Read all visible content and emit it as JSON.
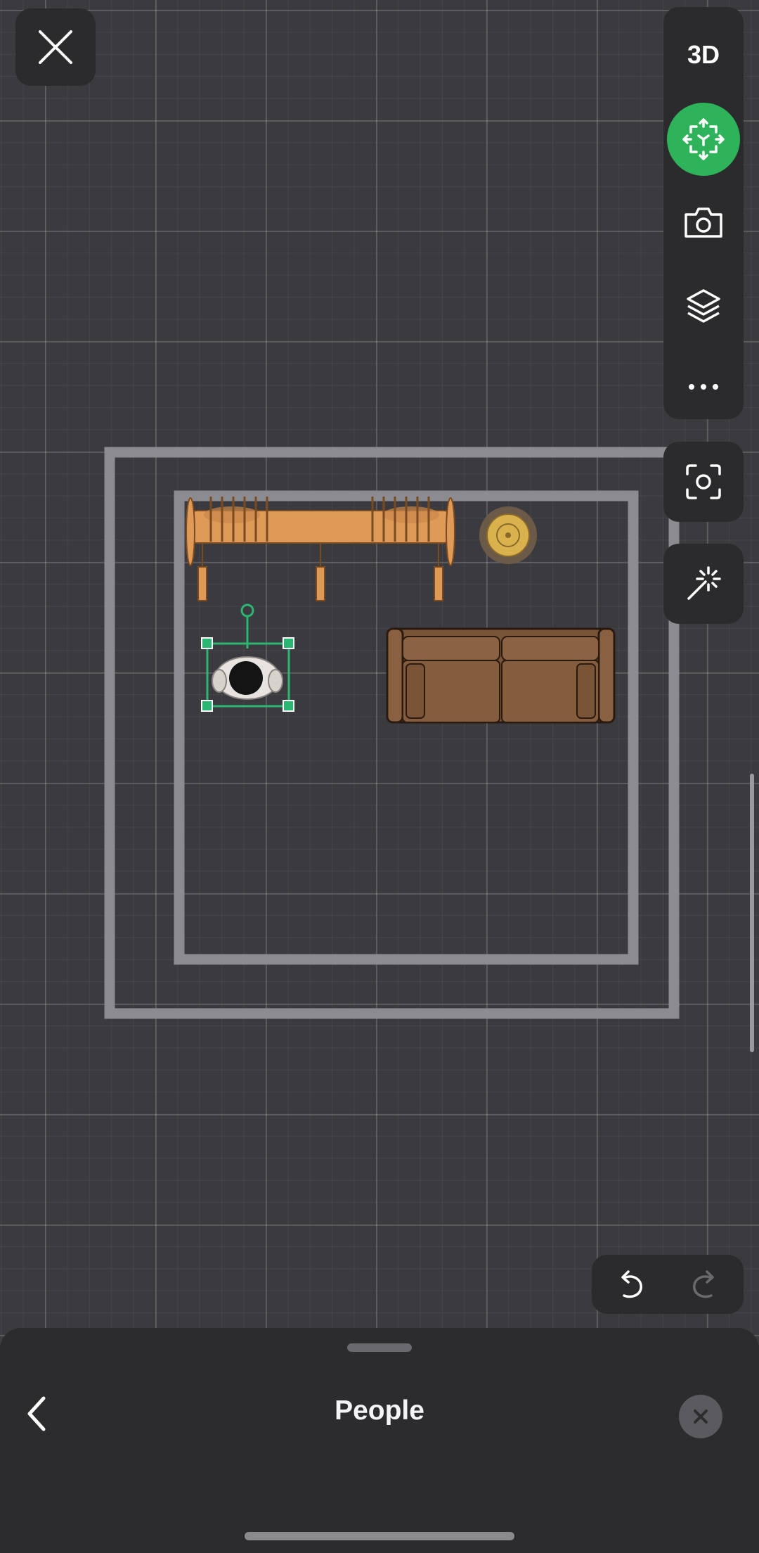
{
  "toolbar": {
    "view_mode_label": "3D",
    "close_icon": "close-icon",
    "move_icon": "move-arrows-icon",
    "camera_icon": "camera-icon",
    "layers_icon": "layers-icon",
    "more_icon": "more-icon",
    "scan_icon": "scan-frame-icon",
    "magic_icon": "magic-wand-icon",
    "accent_color": "#2fb35a"
  },
  "history": {
    "undo_icon": "undo-icon",
    "redo_icon": "redo-icon"
  },
  "floor_plan": {
    "objects": [
      "bench-with-chairs",
      "round-side-table",
      "sofa",
      "person"
    ],
    "selected_object": "person",
    "selection_color": "#2bb673"
  },
  "bottom_sheet": {
    "title": "People",
    "back_icon": "chevron-left-icon",
    "clear_icon": "clear-icon"
  }
}
